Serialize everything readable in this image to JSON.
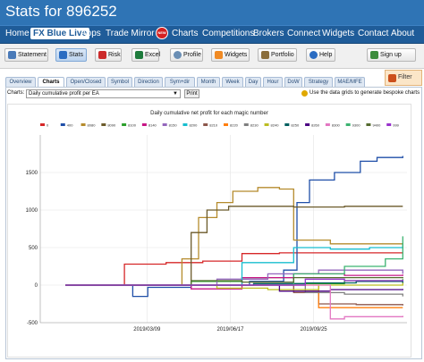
{
  "window": {
    "title": "Stats for 896252"
  },
  "nav": {
    "items": [
      "Home",
      "FX Blue Live",
      "Apps",
      "Trade Mirror",
      "Charts",
      "Competitions",
      "Brokers",
      "Connect",
      "Widgets",
      "Contact",
      "About"
    ],
    "active": "FX Blue Live",
    "badge": "NEW"
  },
  "toolbar": {
    "buttons": [
      "Statement",
      "Stats",
      "Risk",
      "Excel",
      "Profile",
      "Widgets",
      "Portfolio",
      "Help",
      "Sign up"
    ],
    "active": "Stats",
    "filter_label": "Filter"
  },
  "tabs": {
    "items": [
      "Overview",
      "Charts",
      "Open/Closed",
      "Symbol",
      "Direction",
      "Sym+dir",
      "Month",
      "Week",
      "Day",
      "Hour",
      "DoW",
      "Strategy",
      "MAE/MFE"
    ],
    "active": "Charts"
  },
  "chart_picker": {
    "label": "Charts:",
    "selected": "Daily cumulative profit per EA",
    "print_label": "Print",
    "hint": "Use the data grids to generate bespoke charts"
  },
  "colors": {
    "titlebar": "#2f74b5",
    "navbar": "#1f5c99",
    "accent": "#7ea7d6"
  },
  "chart_data": {
    "type": "line",
    "title": "Daily cumulative net profit for each magic number",
    "xlabel": "",
    "ylabel": "",
    "xlim": [
      "2018-11-01",
      "2020-01-15"
    ],
    "ylim": [
      -500,
      2000
    ],
    "yticks": [
      -500,
      0,
      500,
      1000,
      1500
    ],
    "xticks": [
      "2019/03/09",
      "2019/06/17",
      "2019/09/25"
    ],
    "grid": true,
    "legend_position": "top",
    "series": [
      {
        "name": "0",
        "color": "#d62728",
        "points": [
          [
            "2018-12-01",
            0
          ],
          [
            "2019-01-20",
            0
          ],
          [
            "2019-02-10",
            280
          ],
          [
            "2019-04-01",
            300
          ],
          [
            "2019-05-15",
            320
          ],
          [
            "2019-07-01",
            420
          ],
          [
            "2019-08-15",
            430
          ],
          [
            "2019-10-01",
            430
          ],
          [
            "2020-01-10",
            430
          ]
        ]
      },
      {
        "name": "400",
        "color": "#1f4fa8",
        "points": [
          [
            "2018-12-01",
            0
          ],
          [
            "2019-02-15",
            0
          ],
          [
            "2019-02-20",
            -150
          ],
          [
            "2019-03-10",
            -30
          ],
          [
            "2019-05-01",
            0
          ],
          [
            "2019-07-10",
            50
          ],
          [
            "2019-08-20",
            200
          ],
          [
            "2019-09-05",
            1100
          ],
          [
            "2019-09-20",
            1400
          ],
          [
            "2019-10-20",
            1500
          ],
          [
            "2019-11-20",
            1650
          ],
          [
            "2019-12-10",
            1700
          ],
          [
            "2020-01-10",
            1720
          ]
        ]
      },
      {
        "name": "8080",
        "color": "#b58b2c",
        "points": [
          [
            "2018-12-01",
            0
          ],
          [
            "2019-03-15",
            0
          ],
          [
            "2019-04-20",
            350
          ],
          [
            "2019-05-10",
            900
          ],
          [
            "2019-06-01",
            1100
          ],
          [
            "2019-06-20",
            1250
          ],
          [
            "2019-07-20",
            1300
          ],
          [
            "2019-08-15",
            1280
          ],
          [
            "2019-09-01",
            600
          ],
          [
            "2019-10-15",
            550
          ],
          [
            "2020-01-10",
            540
          ]
        ]
      },
      {
        "name": "8090",
        "color": "#6b5a2a",
        "points": [
          [
            "2018-12-01",
            0
          ],
          [
            "2019-04-10",
            0
          ],
          [
            "2019-05-01",
            700
          ],
          [
            "2019-05-20",
            1000
          ],
          [
            "2019-06-15",
            1050
          ],
          [
            "2019-08-01",
            1050
          ],
          [
            "2019-09-01",
            1040
          ],
          [
            "2019-11-01",
            1050
          ],
          [
            "2020-01-10",
            1050
          ]
        ]
      },
      {
        "name": "8100",
        "color": "#2ca02c",
        "points": [
          [
            "2018-12-01",
            0
          ],
          [
            "2019-03-01",
            0
          ],
          [
            "2019-05-01",
            50
          ],
          [
            "2019-07-01",
            100
          ],
          [
            "2019-09-01",
            20
          ],
          [
            "2019-11-01",
            60
          ],
          [
            "2020-01-10",
            80
          ]
        ]
      },
      {
        "name": "8140",
        "color": "#c71585",
        "points": [
          [
            "2018-12-01",
            0
          ],
          [
            "2019-03-01",
            0
          ],
          [
            "2019-05-01",
            -50
          ],
          [
            "2019-07-01",
            100
          ],
          [
            "2019-09-01",
            150
          ],
          [
            "2019-11-01",
            130
          ],
          [
            "2020-01-10",
            140
          ]
        ]
      },
      {
        "name": "8150",
        "color": "#9467bd",
        "points": [
          [
            "2018-12-01",
            0
          ],
          [
            "2019-04-01",
            0
          ],
          [
            "2019-06-01",
            80
          ],
          [
            "2019-08-01",
            150
          ],
          [
            "2019-10-01",
            200
          ],
          [
            "2020-01-10",
            150
          ]
        ]
      },
      {
        "name": "8200",
        "color": "#17becf",
        "points": [
          [
            "2018-12-01",
            0
          ],
          [
            "2019-05-01",
            0
          ],
          [
            "2019-07-01",
            300
          ],
          [
            "2019-09-01",
            500
          ],
          [
            "2019-10-15",
            480
          ],
          [
            "2019-12-01",
            500
          ],
          [
            "2020-01-10",
            560
          ]
        ]
      },
      {
        "name": "8210",
        "color": "#8c564b",
        "points": [
          [
            "2018-12-01",
            0
          ],
          [
            "2019-06-01",
            0
          ],
          [
            "2019-09-01",
            -100
          ],
          [
            "2019-10-01",
            -250
          ],
          [
            "2019-11-15",
            -260
          ],
          [
            "2020-01-10",
            -270
          ]
        ]
      },
      {
        "name": "8220",
        "color": "#ff7f0e",
        "points": [
          [
            "2018-12-01",
            0
          ],
          [
            "2019-09-01",
            0
          ],
          [
            "2019-10-01",
            -300
          ],
          [
            "2020-01-10",
            -300
          ]
        ]
      },
      {
        "name": "8230",
        "color": "#7f7f7f",
        "points": [
          [
            "2018-12-01",
            0
          ],
          [
            "2019-08-15",
            0
          ],
          [
            "2019-09-15",
            -100
          ],
          [
            "2019-11-01",
            -120
          ],
          [
            "2020-01-10",
            -150
          ]
        ]
      },
      {
        "name": "8240",
        "color": "#bcbd22",
        "points": [
          [
            "2018-12-01",
            0
          ],
          [
            "2019-04-01",
            0
          ],
          [
            "2019-06-01",
            -40
          ],
          [
            "2019-08-01",
            -60
          ],
          [
            "2019-10-01",
            0
          ],
          [
            "2020-01-10",
            40
          ]
        ]
      },
      {
        "name": "8250",
        "color": "#005f5f",
        "points": [
          [
            "2018-12-01",
            0
          ],
          [
            "2019-05-15",
            0
          ],
          [
            "2019-07-15",
            20
          ],
          [
            "2019-09-15",
            30
          ],
          [
            "2019-11-15",
            50
          ],
          [
            "2020-01-10",
            30
          ]
        ]
      },
      {
        "name": "8260",
        "color": "#4b0082",
        "points": [
          [
            "2018-12-01",
            0
          ],
          [
            "2019-06-15",
            0
          ],
          [
            "2019-08-15",
            -80
          ],
          [
            "2019-10-15",
            -60
          ],
          [
            "2020-01-10",
            -50
          ]
        ]
      },
      {
        "name": "8300",
        "color": "#e377c2",
        "points": [
          [
            "2018-12-01",
            0
          ],
          [
            "2019-09-01",
            0
          ],
          [
            "2019-10-15",
            -450
          ],
          [
            "2019-11-01",
            -420
          ],
          [
            "2020-01-10",
            -410
          ]
        ]
      },
      {
        "name": "9300",
        "color": "#3cb371",
        "points": [
          [
            "2018-12-01",
            0
          ],
          [
            "2019-07-01",
            0
          ],
          [
            "2019-09-01",
            150
          ],
          [
            "2019-11-01",
            250
          ],
          [
            "2019-12-20",
            350
          ],
          [
            "2020-01-10",
            650
          ]
        ]
      },
      {
        "name": "9400",
        "color": "#556b2f",
        "points": [
          [
            "2018-12-01",
            0
          ],
          [
            "2019-03-01",
            0
          ],
          [
            "2019-05-01",
            60
          ],
          [
            "2019-07-01",
            40
          ],
          [
            "2019-09-01",
            100
          ],
          [
            "2020-01-10",
            90
          ]
        ]
      },
      {
        "name": "999",
        "color": "#9932cc",
        "points": [
          [
            "2018-12-01",
            0
          ],
          [
            "2019-08-01",
            0
          ],
          [
            "2019-09-15",
            80
          ],
          [
            "2019-11-01",
            60
          ],
          [
            "2020-01-10",
            70
          ]
        ]
      }
    ]
  }
}
